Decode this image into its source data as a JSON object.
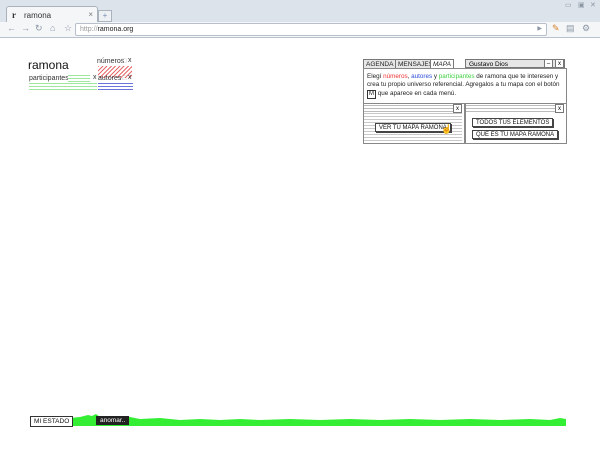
{
  "browser": {
    "tab_title": "ramona",
    "url_protocol": "http://",
    "url_host": "ramona.org"
  },
  "site": {
    "logo": "ramona",
    "filters": {
      "numeros_label": "números",
      "participantes_label": "participantes",
      "autores_label": "autores",
      "close_symbol": "x"
    }
  },
  "panel": {
    "tabs": [
      "AGENDA",
      "MENSAJES",
      "MAPA"
    ],
    "active_tab": "MAPA",
    "user_name": "Gustavo Dios",
    "minimize_symbol": "–",
    "close_symbol": "x",
    "description": {
      "part1": "Elegí ",
      "numeros": "números",
      "sep1": ", ",
      "autores": "autores",
      "sep2": " y ",
      "participantes": "participantes",
      "part2": " de ramona que te interesen y crea tu propio universo referencial. Agregalos a tu mapa con el botón ",
      "button_key": "M",
      "part3": " que aparece en cada menú."
    },
    "ver_mapa_button": "VER TU MAPA RAMONA",
    "todos_button": "TODOS TUS ELEMENTOS",
    "que_es_button": "QUE ES TU MAPA RAMONA"
  },
  "footer": {
    "mi_estado": "MI ESTADO",
    "anomar": "anomar.."
  },
  "colors": {
    "numeros": "#e33333",
    "autores": "#2a4bd6",
    "participantes": "#3fcf3f",
    "activity": "#33ee33"
  }
}
